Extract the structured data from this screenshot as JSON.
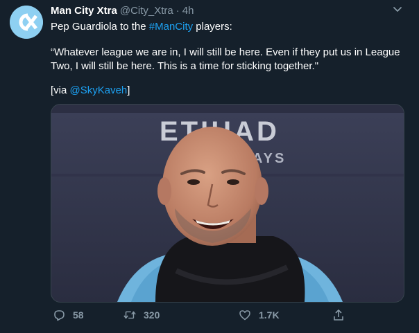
{
  "tweet": {
    "author_name": "Man City Xtra",
    "author_handle": "@City_Xtra",
    "separator": "·",
    "time": "4h",
    "line1_prefix": "Pep Guardiola to the ",
    "hashtag": "#ManCity",
    "line1_suffix": " players:",
    "quote": "“Whatever league we are in, I will still be here. Even if they put us in League Two, I will still be here. This is a time for sticking together.\"",
    "via_prefix": "[via ",
    "via_mention": "@SkyKaveh",
    "via_suffix": "]",
    "media_sign_text": "ETIHAD",
    "media_sign_subtext": "AYS"
  },
  "actions": {
    "reply_count": "58",
    "retweet_count": "320",
    "like_count": "1.7K"
  },
  "icons": {
    "avatar": "man-city-xtra-logo",
    "caret": "chevron-down-icon",
    "reply": "reply-icon",
    "retweet": "retweet-icon",
    "like": "heart-icon",
    "share": "share-icon"
  },
  "colors": {
    "background": "#15202b",
    "text": "#ffffff",
    "secondary": "#8899a6",
    "link": "#1da1f2",
    "avatar_bg": "#8ed0f2"
  }
}
